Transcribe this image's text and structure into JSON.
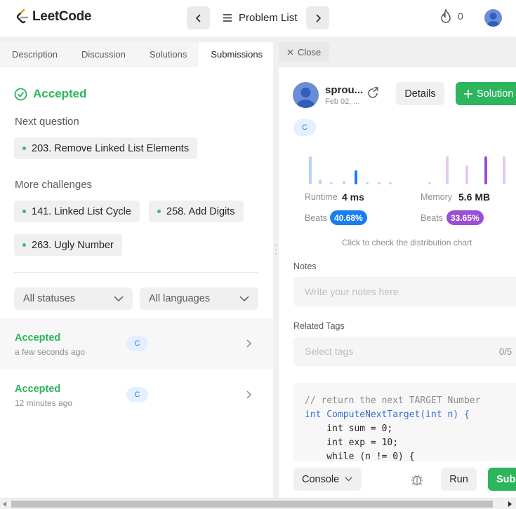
{
  "header": {
    "logo_text": "LeetCode",
    "problem_list_label": "Problem List",
    "streak_count": "0"
  },
  "left": {
    "tabs": [
      {
        "label": "Description"
      },
      {
        "label": "Discussion"
      },
      {
        "label": "Solutions"
      },
      {
        "label": "Submissions"
      }
    ],
    "status_title": "Accepted",
    "next_question_label": "Next question",
    "next_question": "203. Remove Linked List Elements",
    "more_challenges_label": "More challenges",
    "challenges": [
      {
        "label": "141. Linked List Cycle"
      },
      {
        "label": "258. Add Digits"
      },
      {
        "label": "263. Ugly Number"
      }
    ],
    "filter_status": "All statuses",
    "filter_language": "All languages",
    "submissions": [
      {
        "status": "Accepted",
        "time": "a few seconds ago",
        "lang": "C"
      },
      {
        "status": "Accepted",
        "time": "12 minutes ago",
        "lang": "C"
      }
    ]
  },
  "right": {
    "close_label": "Close",
    "username": "sprou...",
    "date": "Feb 02, ...",
    "details_label": "Details",
    "solution_label": "Solution",
    "lang": "C",
    "runtime_label": "Runtime",
    "runtime_value": "4 ms",
    "runtime_beats_label": "Beats",
    "runtime_beats": "40.68%",
    "memory_label": "Memory",
    "memory_value": "5.6 MB",
    "memory_beats_label": "Beats",
    "memory_beats": "33.65%",
    "chart_hint": "Click to check the distribution chart",
    "notes_label": "Notes",
    "notes_placeholder": "Write your notes here",
    "tags_label": "Related Tags",
    "tags_placeholder": "Select tags",
    "tags_count": "0/5",
    "code_lines": [
      "// return the next TARGET Number",
      "int ComputeNextTarget(int n) {",
      "    int sum = 0;",
      "    int exp = 10;",
      "    while (n != 0) {"
    ],
    "console_label": "Console",
    "run_label": "Run",
    "submit_label": "Subm"
  },
  "colors": {
    "accent_green": "#2db55d",
    "runtime_blue": "#1a7ef2",
    "memory_purple": "#9a4fd6"
  }
}
